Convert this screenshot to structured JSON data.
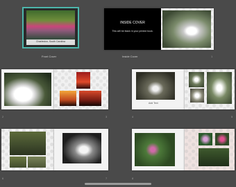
{
  "front_cover": {
    "label": "Front Cover",
    "caption": "Charleston, South Carolina"
  },
  "inside_cover": {
    "label": "Inside Cover",
    "title": "INSIDE COVER",
    "subtitle": "This will be blank in your printed book."
  },
  "page_numbers": [
    "1",
    "2",
    "3",
    "4",
    "5",
    "6",
    "7",
    "8"
  ],
  "page4_caption": "Add Text",
  "colors": {
    "background": "#4a4a4a",
    "selection": "#4db6ac"
  }
}
